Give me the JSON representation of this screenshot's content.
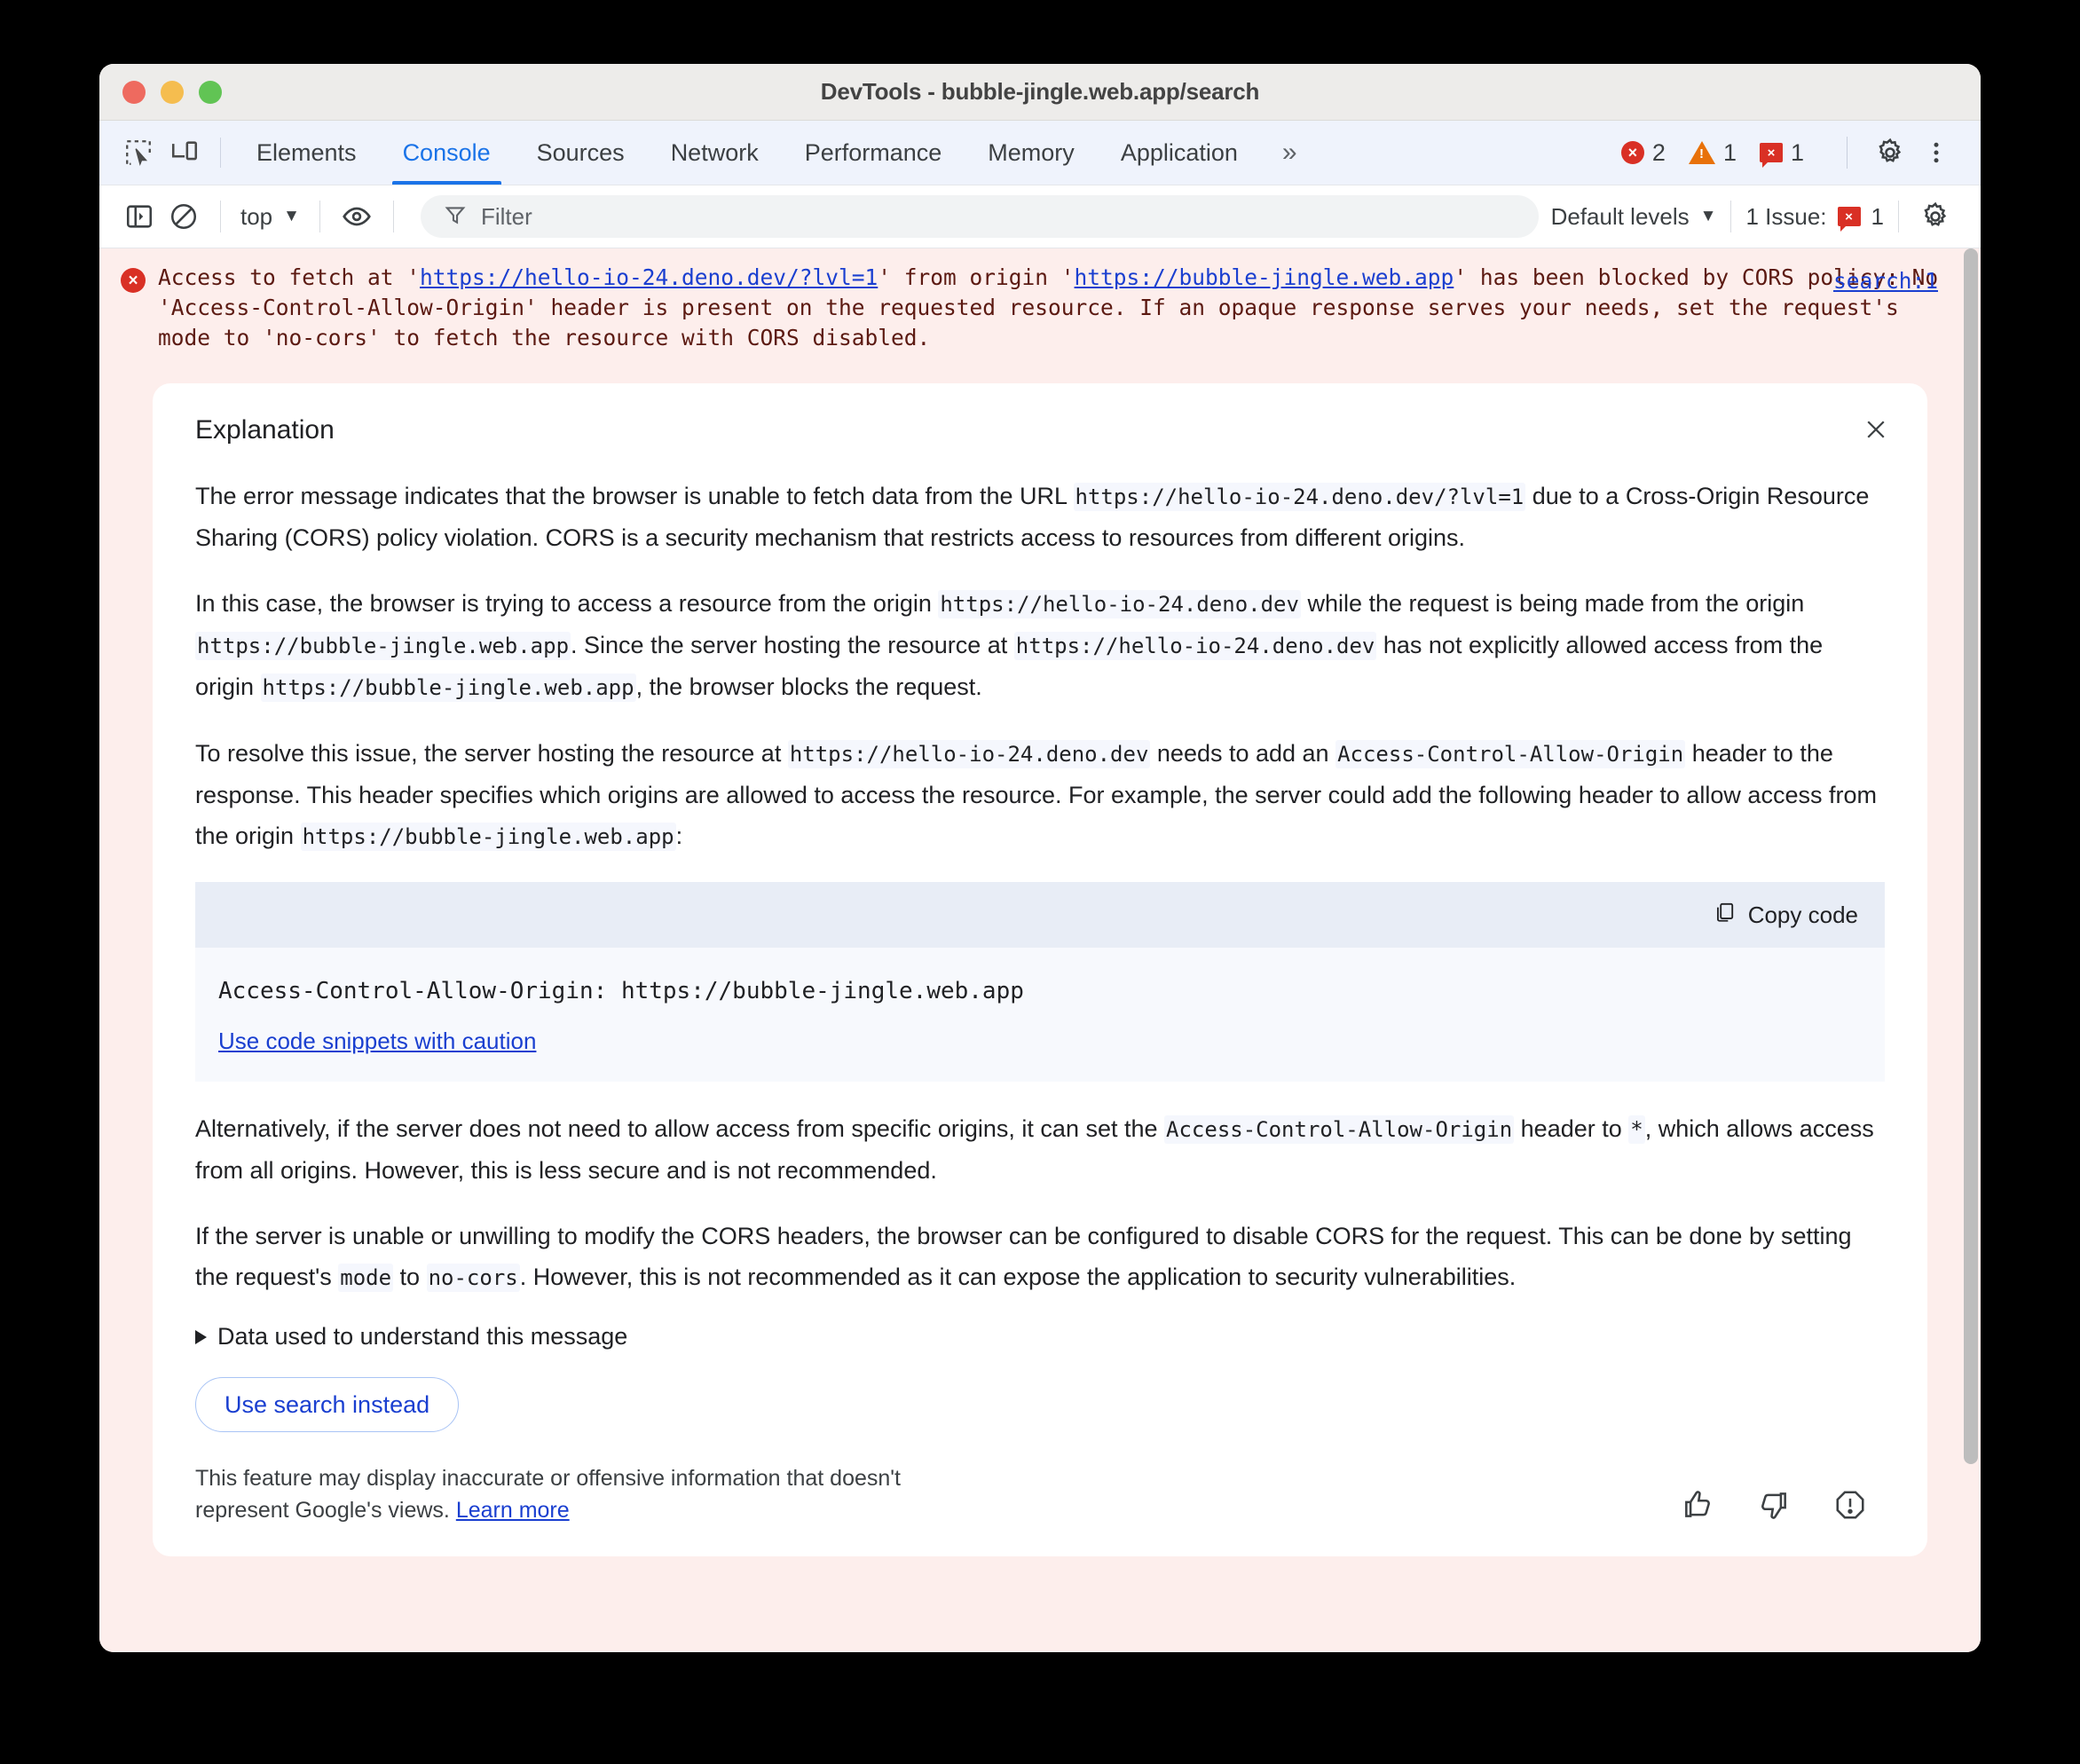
{
  "window": {
    "title": "DevTools - bubble-jingle.web.app/search",
    "traffic_lights": [
      "close",
      "minimize",
      "zoom"
    ]
  },
  "tabbar": {
    "inspect_icon": "inspect-element-icon",
    "device_icon": "device-toolbar-icon",
    "tabs": [
      {
        "label": "Elements",
        "active": false
      },
      {
        "label": "Console",
        "active": true
      },
      {
        "label": "Sources",
        "active": false
      },
      {
        "label": "Network",
        "active": false
      },
      {
        "label": "Performance",
        "active": false
      },
      {
        "label": "Memory",
        "active": false
      },
      {
        "label": "Application",
        "active": false
      }
    ],
    "more_tabs": "»",
    "counters": {
      "errors": "2",
      "warnings": "1",
      "issues": "1",
      "error_glyph": "×",
      "warning_glyph": "!",
      "issue_glyph": "×"
    },
    "settings_icon": "gear-icon",
    "more_icon": "kebab-menu-icon"
  },
  "console_toolbar": {
    "sidebar_icon": "console-sidebar-icon",
    "clear_icon": "clear-console-icon",
    "context": "top",
    "context_caret": "▼",
    "eye_icon": "live-expression-icon",
    "filter_icon": "filter-icon",
    "filter_value": "",
    "filter_placeholder": "Filter",
    "levels_label": "Default levels",
    "levels_caret": "▼",
    "issues_label": "1 Issue:",
    "issues_count": "1",
    "settings_icon": "console-settings-gear-icon"
  },
  "console_message": {
    "badge": "×",
    "prefix": "Access to fetch at '",
    "url1": "https://hello-io-24.deno.dev/?lvl=1",
    "middle": "' from origin '",
    "url2": "https://bubble-jingle.web.app",
    "suffix": "' has been blocked by CORS policy: No 'Access-Control-Allow-Origin' header is present on the requested resource. If an opaque response serves your needs, set the request's mode to 'no-cors' to fetch the resource with CORS disabled.",
    "source_link": "search:1"
  },
  "explanation": {
    "title": "Explanation",
    "close_icon": "close-icon",
    "paragraph1": {
      "part1": "The error message indicates that the browser is unable to fetch data from the URL ",
      "code1": "https://hello-io-24.deno.dev/?lvl=1",
      "part2": " due to a Cross-Origin Resource Sharing (CORS) policy violation. CORS is a security mechanism that restricts access to resources from different origins."
    },
    "paragraph2": {
      "part1": "In this case, the browser is trying to access a resource from the origin ",
      "code1": "https://hello-io-24.deno.dev",
      "part2": " while the request is being made from the origin ",
      "code2": "https://bubble-jingle.web.app",
      "part3": ". Since the server hosting the resource at ",
      "code3": "https://hello-io-24.deno.dev",
      "part4": " has not explicitly allowed access from the origin ",
      "code4": "https://bubble-jingle.web.app",
      "part5": ", the browser blocks the request."
    },
    "paragraph3": {
      "part1": "To resolve this issue, the server hosting the resource at ",
      "code1": "https://hello-io-24.deno.dev",
      "part2": " needs to add an ",
      "code2": "Access-Control-Allow-Origin",
      "part3": " header to the response. This header specifies which origins are allowed to access the resource. For example, the server could add the following header to allow access from the origin ",
      "code3": "https://bubble-jingle.web.app",
      "part4": ":"
    },
    "code_block": {
      "copy_label": "Copy code",
      "copy_icon": "copy-icon",
      "snippet": "Access-Control-Allow-Origin: https://bubble-jingle.web.app",
      "caution_link": "Use code snippets with caution"
    },
    "paragraph4": {
      "part1": "Alternatively, if the server does not need to allow access from specific origins, it can set the ",
      "code1": "Access-Control-Allow-Origin",
      "part2": " header to ",
      "code2": "*",
      "part3": ", which allows access from all origins. However, this is less secure and is not recommended."
    },
    "paragraph5": {
      "part1": "If the server is unable or unwilling to modify the CORS headers, the browser can be configured to disable CORS for the request. This can be done by setting the request's ",
      "code1": "mode",
      "part2": " to ",
      "code2": "no-cors",
      "part3": ". However, this is not recommended as it can expose the application to security vulnerabilities."
    },
    "disclosure_label": "Data used to understand this message",
    "disclosure_icon": "chevron-right-icon",
    "search_button": "Use search instead",
    "disclaimer": {
      "text": "This feature may display inaccurate or offensive information that doesn't represent Google's views. ",
      "link": "Learn more"
    },
    "feedback": {
      "thumb_up_icon": "thumb-up-icon",
      "thumb_down_icon": "thumb-down-icon",
      "report_icon": "report-icon"
    }
  },
  "colors": {
    "accent": "#1a73e8",
    "link": "#1a3fd0",
    "error": "#d93025",
    "warning": "#e8710a",
    "error_bg": "#fdeeec"
  }
}
